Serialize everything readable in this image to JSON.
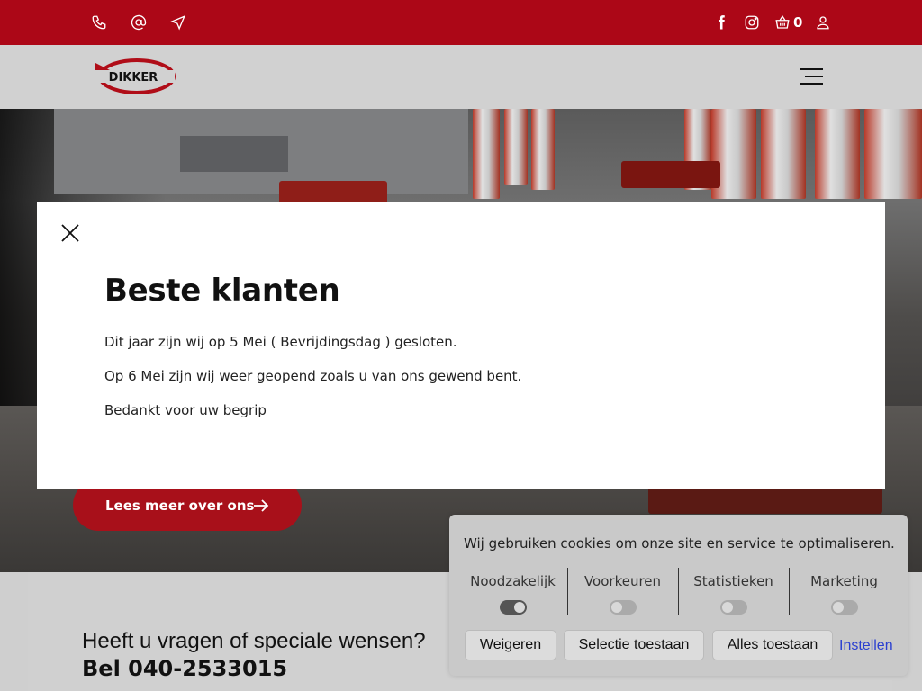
{
  "topbar": {
    "icons": [
      "phone-icon",
      "at-icon",
      "location-arrow-icon",
      "facebook-icon",
      "instagram-icon",
      "basket-icon",
      "user-icon"
    ],
    "cart_count": "0"
  },
  "header": {
    "logo_text": "DIKKER",
    "menu_icon": "hamburger-icon"
  },
  "hero": {
    "cta_label": "Lees meer over ons"
  },
  "contact": {
    "question": "Heeft u vragen of speciale wensen?",
    "phone_line": "Bel 040-2533015"
  },
  "modal": {
    "title": "Beste klanten",
    "paragraphs": [
      "Dit jaar zijn wij op 5 Mei ( Bevrijdingsdag ) gesloten.",
      "Op 6 Mei zijn wij weer geopend zoals u van ons gewend bent.",
      "Bedankt voor uw begrip"
    ]
  },
  "cookie": {
    "message": "Wij gebruiken cookies om onze site en service te optimaliseren.",
    "categories": [
      {
        "label": "Noodzakelijk",
        "enabled": true
      },
      {
        "label": "Voorkeuren",
        "enabled": false
      },
      {
        "label": "Statistieken",
        "enabled": false
      },
      {
        "label": "Marketing",
        "enabled": false
      }
    ],
    "buttons": {
      "reject": "Weigeren",
      "allow_selection": "Selectie toestaan",
      "allow_all": "Alles toestaan"
    },
    "settings_link": "Instellen"
  },
  "colors": {
    "brand_red": "#ac0717",
    "cta_red": "#a8101a",
    "link_blue": "#2a3fd0"
  }
}
